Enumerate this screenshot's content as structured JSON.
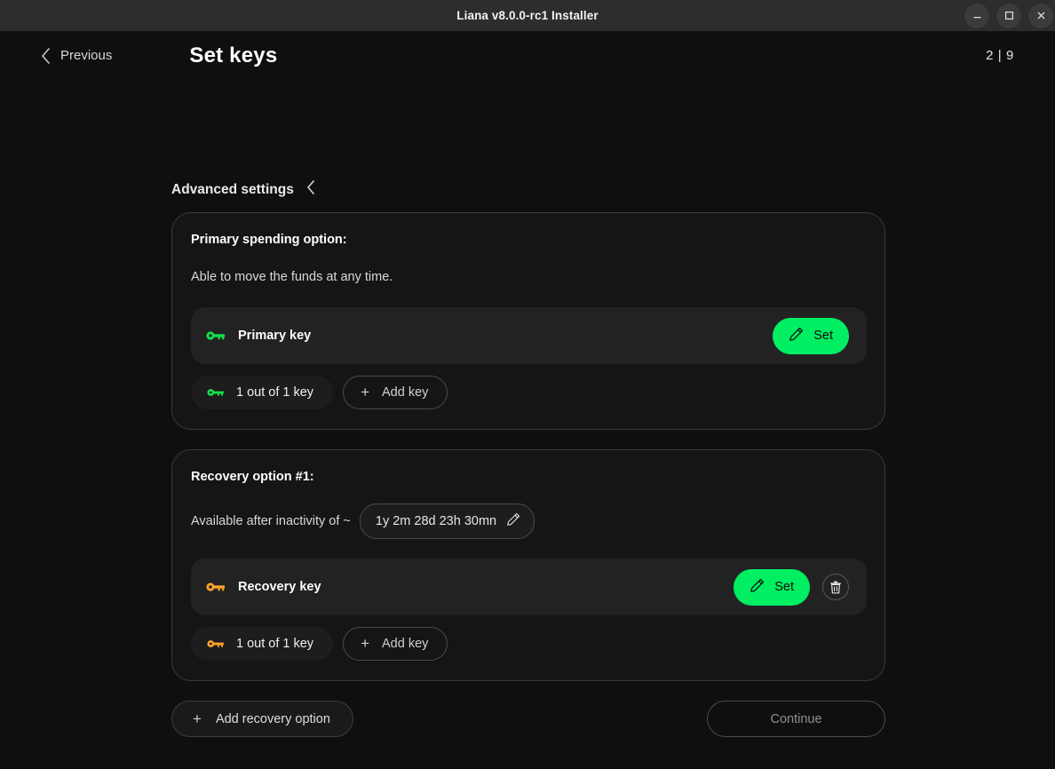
{
  "window": {
    "title": "Liana v8.0.0-rc1 Installer",
    "controls": [
      {
        "name": "minimize",
        "glyph": "minimize-icon"
      },
      {
        "name": "maximize",
        "glyph": "maximize-icon"
      },
      {
        "name": "close",
        "glyph": "close-icon"
      }
    ]
  },
  "header": {
    "previous_label": "Previous",
    "back_icon": "chevron-left-icon",
    "title": "Set keys",
    "page_indicator": "2 | 9"
  },
  "advanced": {
    "label": "Advanced settings",
    "toggle_icon": "chevron-left-icon"
  },
  "primary": {
    "title": "Primary spending option:",
    "description": "Able to move the funds at any time.",
    "key": {
      "icon": "key-icon",
      "label": "Primary key",
      "set_label": "Set",
      "set_icon": "pencil-icon"
    },
    "threshold_label": "1 out of 1 key",
    "threshold_icon": "key-icon",
    "add_key_label": "Add key",
    "add_key_icon": "plus-icon"
  },
  "recovery": {
    "title": "Recovery option #1:",
    "description_prefix": "Available after inactivity of ~",
    "duration": "1y 2m 28d 23h 30mn",
    "duration_edit_icon": "pencil-icon",
    "key": {
      "icon": "key-icon",
      "label": "Recovery key",
      "set_label": "Set",
      "set_icon": "pencil-icon",
      "delete_icon": "trash-icon"
    },
    "threshold_label": "1 out of 1 key",
    "threshold_icon": "key-icon",
    "add_key_label": "Add key",
    "add_key_icon": "plus-icon"
  },
  "footer": {
    "add_recovery_label": "Add recovery option",
    "add_recovery_icon": "plus-icon",
    "continue_label": "Continue"
  },
  "colors": {
    "accent_green": "#00ef62",
    "accent_orange": "#ffa32b",
    "page_background": "#0f0f0f",
    "card_background": "#151515",
    "row_background": "#222222",
    "titlebar_background": "#2d2d2d"
  }
}
